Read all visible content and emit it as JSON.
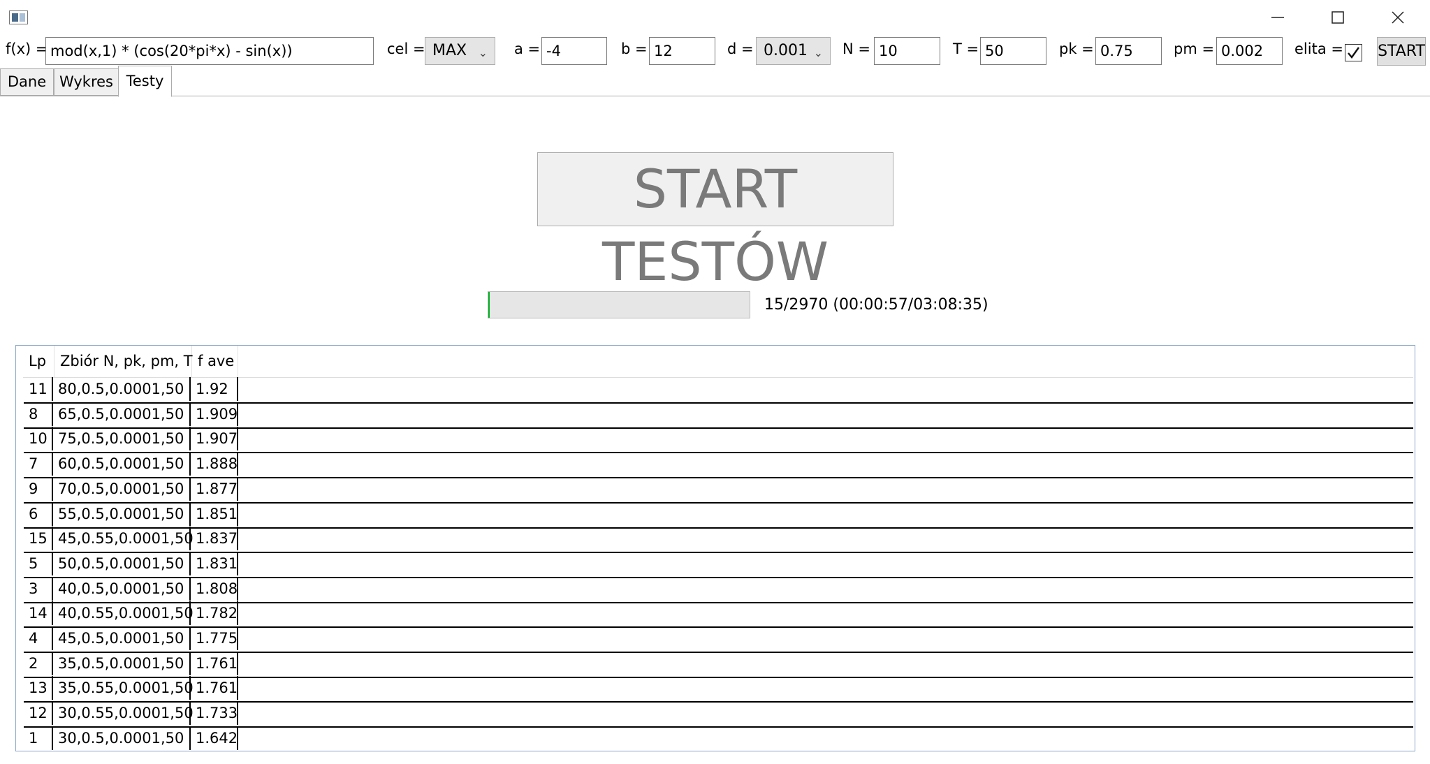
{
  "window": {
    "minimize": "minimize",
    "maximize": "maximize",
    "close": "close"
  },
  "toolbar": {
    "fx_label": "f(x) =",
    "fx_value": "mod(x,1) * (cos(20*pi*x) - sin(x))",
    "cel_label": "cel =",
    "cel_value": "MAX",
    "a_label": "a =",
    "a_value": "-4",
    "b_label": "b =",
    "b_value": "12",
    "d_label": "d =",
    "d_value": "0.001",
    "n_label": "N =",
    "n_value": "10",
    "t_label": "T =",
    "t_value": "50",
    "pk_label": "pk =",
    "pk_value": "0.75",
    "pm_label": "pm =",
    "pm_value": "0.002",
    "elita_label": "elita =",
    "elita_checked": true,
    "start_label": "START"
  },
  "tabs": [
    {
      "label": "Dane",
      "active": false
    },
    {
      "label": "Wykres",
      "active": false
    },
    {
      "label": "Testy",
      "active": true
    }
  ],
  "tests": {
    "start_button": "START TESTÓW",
    "progress_fraction": 0.005,
    "progress_text": "15/2970 (00:00:57/03:08:35)"
  },
  "table": {
    "headers": [
      "Lp",
      "Zbiór N, pk, pm, T",
      "f ave"
    ],
    "rows": [
      [
        "11",
        "80,0.5,0.0001,50",
        "1.92"
      ],
      [
        "8",
        "65,0.5,0.0001,50",
        "1.909"
      ],
      [
        "10",
        "75,0.5,0.0001,50",
        "1.907"
      ],
      [
        "7",
        "60,0.5,0.0001,50",
        "1.888"
      ],
      [
        "9",
        "70,0.5,0.0001,50",
        "1.877"
      ],
      [
        "6",
        "55,0.5,0.0001,50",
        "1.851"
      ],
      [
        "15",
        "45,0.55,0.0001,50",
        "1.837"
      ],
      [
        "5",
        "50,0.5,0.0001,50",
        "1.831"
      ],
      [
        "3",
        "40,0.5,0.0001,50",
        "1.808"
      ],
      [
        "14",
        "40,0.55,0.0001,50",
        "1.782"
      ],
      [
        "4",
        "45,0.5,0.0001,50",
        "1.775"
      ],
      [
        "2",
        "35,0.5,0.0001,50",
        "1.761"
      ],
      [
        "13",
        "35,0.55,0.0001,50",
        "1.761"
      ],
      [
        "12",
        "30,0.55,0.0001,50",
        "1.733"
      ],
      [
        "1",
        "30,0.5,0.0001,50",
        "1.642"
      ]
    ]
  }
}
